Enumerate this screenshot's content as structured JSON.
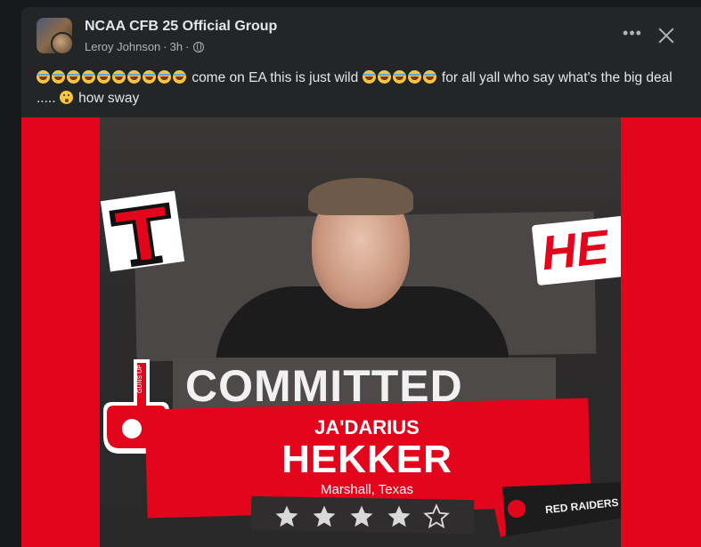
{
  "post": {
    "group_name": "NCAA CFB 25 Official Group",
    "author": "Leroy Johnson",
    "time": "3h",
    "separator": "·",
    "more_label": "•••",
    "caption_a": "come on EA this is just wild",
    "caption_b": "for all yall who say what's the big deal .....",
    "caption_c": "how sway"
  },
  "graphic": {
    "committed_label": "COMMITTED",
    "first_name": "JA'DARIUS",
    "last_name": "HEKKER",
    "hometown": "Marshall, Texas",
    "team_label": "RED RAIDERS",
    "side_badge_text": "HE",
    "foam_finger_text": "GUNS UP",
    "star_rating": 4,
    "stars_max": 5,
    "brand_red": "#e3051b"
  },
  "icons": [
    "group-avatar-icon",
    "globe-icon",
    "more-options-icon",
    "close-icon",
    "laughing-emoji-icon",
    "hushed-emoji-icon",
    "star-icon"
  ]
}
